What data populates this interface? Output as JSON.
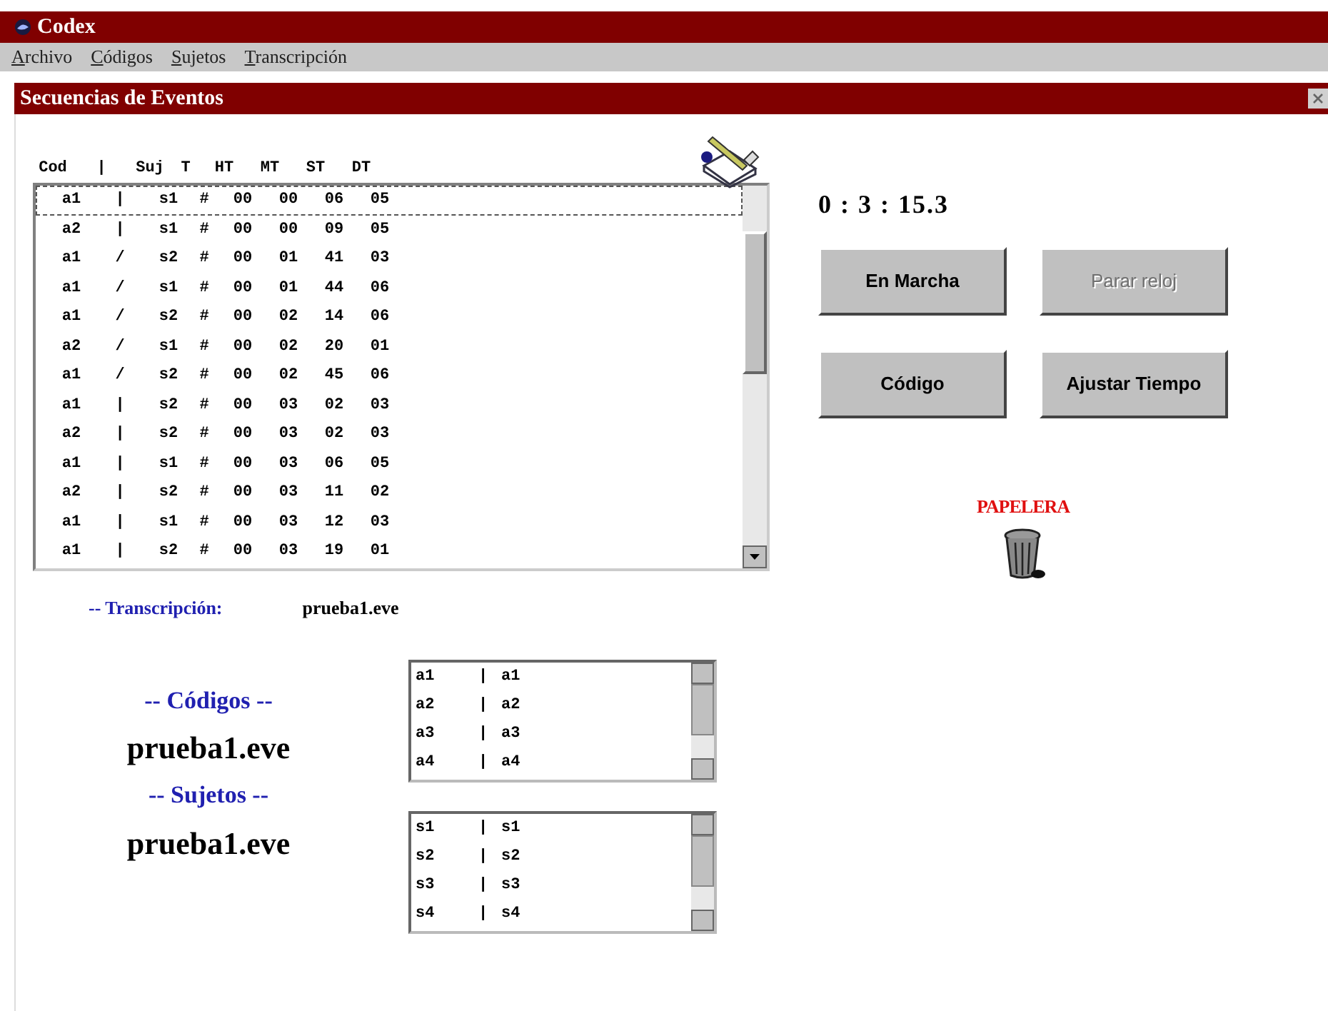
{
  "window": {
    "title": "Codex"
  },
  "menu": [
    "Archivo",
    "Códigos",
    "Sujetos",
    "Transcripción"
  ],
  "panel": {
    "title": "Secuencias de Eventos"
  },
  "events": {
    "columns": [
      "Cod",
      "|",
      "Suj",
      "T",
      "HT",
      "MT",
      "ST",
      "DT"
    ],
    "rows": [
      {
        "cells": [
          "a1",
          "|",
          "s1",
          "#",
          "00",
          "00",
          "06",
          "05"
        ],
        "selected": true
      },
      {
        "cells": [
          "a2",
          "|",
          "s1",
          "#",
          "00",
          "00",
          "09",
          "05"
        ],
        "selected": false
      },
      {
        "cells": [
          "a1",
          "/",
          "s2",
          "#",
          "00",
          "01",
          "41",
          "03"
        ],
        "selected": false
      },
      {
        "cells": [
          "a1",
          "/",
          "s1",
          "#",
          "00",
          "01",
          "44",
          "06"
        ],
        "selected": false
      },
      {
        "cells": [
          "a1",
          "/",
          "s2",
          "#",
          "00",
          "02",
          "14",
          "06"
        ],
        "selected": false
      },
      {
        "cells": [
          "a2",
          "/",
          "s1",
          "#",
          "00",
          "02",
          "20",
          "01"
        ],
        "selected": false
      },
      {
        "cells": [
          "a1",
          "/",
          "s2",
          "#",
          "00",
          "02",
          "45",
          "06"
        ],
        "selected": false
      },
      {
        "cells": [
          "a1",
          "|",
          "s2",
          "#",
          "00",
          "03",
          "02",
          "03"
        ],
        "selected": false
      },
      {
        "cells": [
          "a2",
          "|",
          "s2",
          "#",
          "00",
          "03",
          "02",
          "03"
        ],
        "selected": false
      },
      {
        "cells": [
          "a1",
          "|",
          "s1",
          "#",
          "00",
          "03",
          "06",
          "05"
        ],
        "selected": false
      },
      {
        "cells": [
          "a2",
          "|",
          "s2",
          "#",
          "00",
          "03",
          "11",
          "02"
        ],
        "selected": false
      },
      {
        "cells": [
          "a1",
          "|",
          "s1",
          "#",
          "00",
          "03",
          "12",
          "03"
        ],
        "selected": false
      },
      {
        "cells": [
          "a1",
          "|",
          "s2",
          "#",
          "00",
          "03",
          "19",
          "01"
        ],
        "selected": false
      }
    ]
  },
  "clock": "0 : 3 : 15.3",
  "buttons": [
    {
      "label": "En Marcha",
      "disabled": false
    },
    {
      "label": "Parar reloj",
      "disabled": true
    },
    {
      "label": "Código",
      "disabled": false
    },
    {
      "label": "Ajustar Tiempo",
      "disabled": false
    }
  ],
  "trash": {
    "label": "PAPELERA"
  },
  "transcription": {
    "label": "-- Transcripción:",
    "file": "prueba1.eve"
  },
  "codes": {
    "label": "-- Códigos --",
    "file": "prueba1.eve",
    "items": [
      [
        "a1",
        "|",
        "a1"
      ],
      [
        "a2",
        "|",
        "a2"
      ],
      [
        "a3",
        "|",
        "a3"
      ],
      [
        "a4",
        "|",
        "a4"
      ]
    ]
  },
  "subjects": {
    "label": "-- Sujetos --",
    "file": "prueba1.eve",
    "items": [
      [
        "s1",
        "|",
        "s1"
      ],
      [
        "s2",
        "|",
        "s2"
      ],
      [
        "s3",
        "|",
        "s3"
      ],
      [
        "s4",
        "|",
        "s4"
      ]
    ]
  }
}
